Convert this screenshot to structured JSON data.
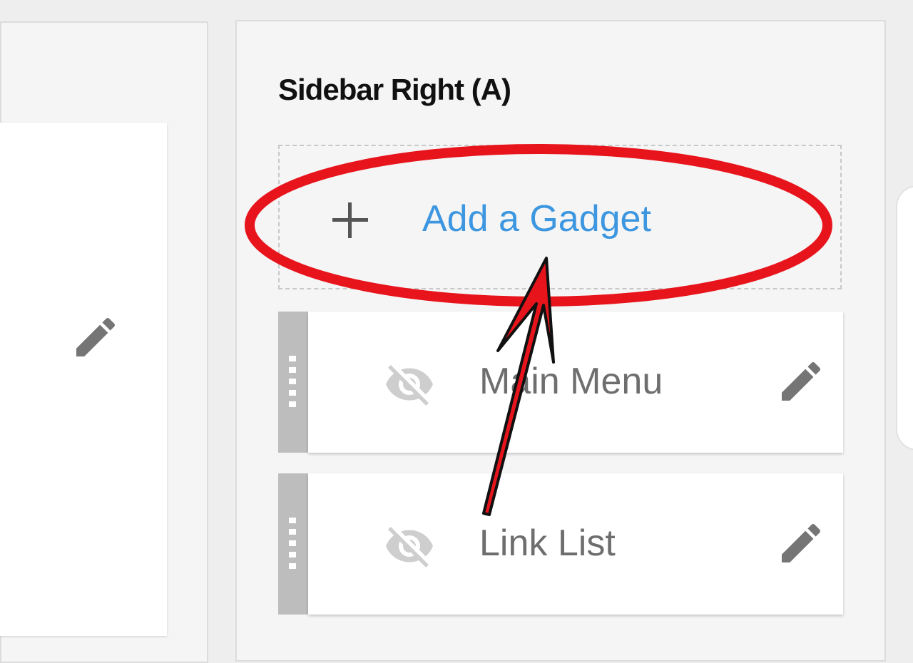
{
  "section": {
    "title": "Sidebar Right (A)"
  },
  "add_gadget": {
    "label": "Add a Gadget",
    "icon": "plus-icon"
  },
  "gadgets": [
    {
      "name": "Main Menu",
      "visibility_icon": "eye-off-icon",
      "edit_icon": "pencil-icon"
    },
    {
      "name": "Link List",
      "visibility_icon": "eye-off-icon",
      "edit_icon": "pencil-icon"
    }
  ],
  "colors": {
    "link": "#3c96e0",
    "annotation": "#e8141c",
    "icon": "#757575"
  }
}
